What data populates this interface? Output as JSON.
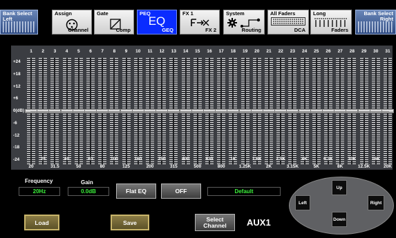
{
  "topnav": {
    "bank_left": {
      "line1": "Bank Select",
      "line2": "Left"
    },
    "assign": {
      "title": "Assign",
      "sub": "Channel"
    },
    "gate": {
      "title": "Gate",
      "sub": "Comp"
    },
    "peq": {
      "title": "PEQ",
      "main": "EQ",
      "sub": "GEQ"
    },
    "fx": {
      "title": "FX 1",
      "sub": "FX 2"
    },
    "system": {
      "title": "System",
      "sub": "Routing"
    },
    "all_faders": {
      "title": "All Faders",
      "sub": "DCA"
    },
    "long": {
      "title": "Long",
      "sub": "Faders"
    },
    "bank_right": {
      "line1": "Bank Select",
      "line2": "Right"
    }
  },
  "geq": {
    "band_numbers": [
      "1",
      "2",
      "3",
      "4",
      "5",
      "6",
      "7",
      "8",
      "9",
      "10",
      "11",
      "12",
      "13",
      "14",
      "15",
      "16",
      "17",
      "18",
      "19",
      "20",
      "21",
      "22",
      "23",
      "24",
      "25",
      "26",
      "27",
      "28",
      "29",
      "30",
      "31"
    ],
    "db_labels": [
      "+24",
      "+18",
      "+12",
      "+6",
      "0(dB)",
      "-6",
      "-12",
      "-18",
      "-24"
    ],
    "gains_db": [
      0,
      0,
      0,
      0,
      0,
      0,
      0,
      0,
      0,
      0,
      0,
      0,
      0,
      0,
      0,
      0,
      0,
      0,
      0,
      0,
      0,
      0,
      0,
      0,
      0,
      0,
      0,
      0,
      0,
      0,
      0
    ],
    "freq_top": [
      "25",
      "40",
      "63",
      "100",
      "160",
      "250",
      "400",
      "630",
      "1K",
      "1.6K",
      "2.5K",
      "4K",
      "6.3K",
      "10K",
      "16K"
    ],
    "freq_bottom": [
      "20",
      "31.5",
      "50",
      "80",
      "125",
      "200",
      "315",
      "500",
      "800",
      "1.25K",
      "2K",
      "3.15K",
      "5K",
      "8K",
      "12.5K",
      "20K"
    ]
  },
  "controls": {
    "frequency_label": "Frequency",
    "frequency_value": "20Hz",
    "gain_label": "Gain",
    "gain_value": "0.0dB",
    "flat_eq": "Flat EQ",
    "off": "OFF",
    "preset": "Default",
    "load": "Load",
    "save": "Save",
    "select_channel": "Select Channel",
    "channel_name": "AUX1"
  },
  "navpad": {
    "up": "Up",
    "down": "Down",
    "left": "Left",
    "right": "Right"
  }
}
